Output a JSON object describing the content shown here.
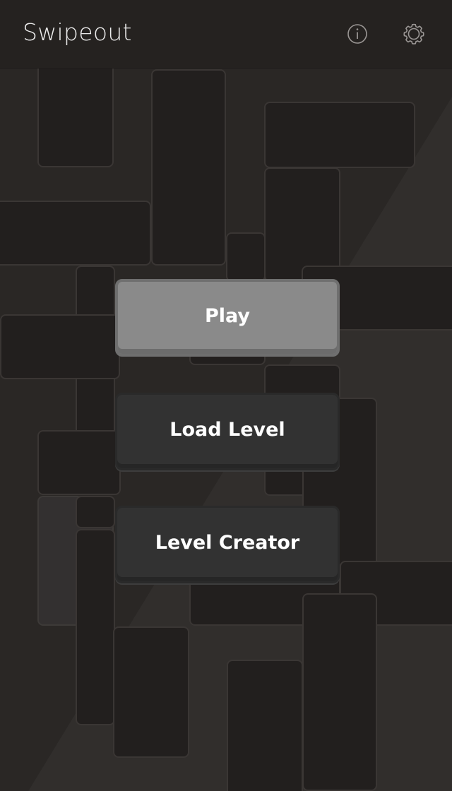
{
  "header": {
    "title": "Swipeout",
    "info_icon": "info-circle-icon",
    "settings_icon": "gear-icon"
  },
  "menu": {
    "play_label": "Play",
    "load_level_label": "Load Level",
    "level_creator_label": "Level Creator"
  },
  "colors": {
    "header_bg": "#252220",
    "board_bg": "#2c2927",
    "block_fill": "#221f1e",
    "block_border": "#3a3634",
    "primary_button": "#8a8a8a",
    "secondary_button": "#323232",
    "text": "#ffffff"
  }
}
